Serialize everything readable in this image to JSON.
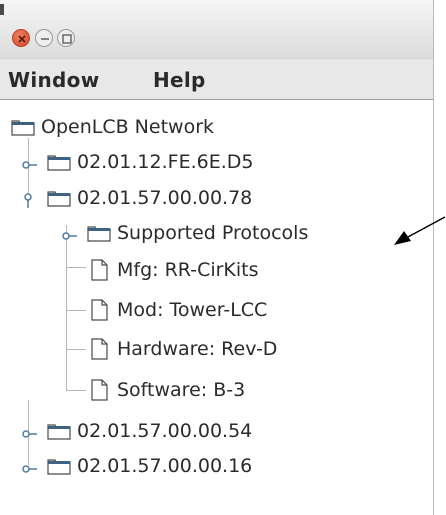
{
  "menubar": {
    "window": "Window",
    "help": "Help"
  },
  "tree": {
    "root": "OpenLCB Network",
    "node1": "02.01.12.FE.6E.D5",
    "node2": "02.01.57.00.00.78",
    "children": {
      "protocols": "Supported Protocols",
      "mfg": "Mfg: RR-CirKits",
      "mod": "Mod: Tower-LCC",
      "hardware": "Hardware: Rev-D",
      "software": "Software: B-3"
    },
    "node3": "02.01.57.00.00.54",
    "node4": "02.01.57.00.00.16"
  },
  "icons": {
    "close": "close-icon",
    "minimize": "minimize-icon",
    "maximize": "maximize-icon",
    "folder": "folder-icon",
    "file": "file-icon",
    "expand": "expand-handle-icon",
    "collapse": "collapse-handle-icon",
    "annotation": "annotation-arrow-icon"
  },
  "colors": {
    "close_button": "#d2452a",
    "folder_tab": "#3e6382",
    "tree_line": "#b6b6b6",
    "handle": "#4f7aa6"
  }
}
